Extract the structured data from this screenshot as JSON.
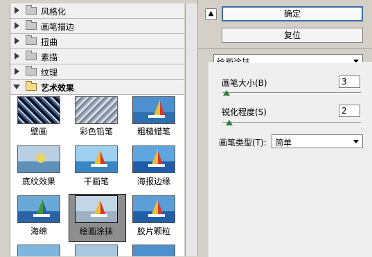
{
  "categories": [
    {
      "label": "风格化"
    },
    {
      "label": "画笔描边"
    },
    {
      "label": "扭曲"
    },
    {
      "label": "素描"
    },
    {
      "label": "纹理"
    },
    {
      "label": "艺术效果"
    }
  ],
  "filters": [
    {
      "label": "壁画"
    },
    {
      "label": "彩色铅笔"
    },
    {
      "label": "粗糙蜡笔"
    },
    {
      "label": "底纹效果"
    },
    {
      "label": "干画笔"
    },
    {
      "label": "海报边缘"
    },
    {
      "label": "海绵"
    },
    {
      "label": "绘画涂抹"
    },
    {
      "label": "胶片颗粒"
    }
  ],
  "buttons": {
    "ok": "确定",
    "reset": "复位"
  },
  "collapse_icon": "▲",
  "selected_filter": "绘画涂抹",
  "params": {
    "brush_size": {
      "label": "画笔大小(B)",
      "value": "3",
      "level_fraction": 0.03
    },
    "sharpness": {
      "label": "锐化程度(S)",
      "value": "2",
      "level_fraction": 0.05
    },
    "brush_type": {
      "label": "画笔类型(T):",
      "value": "简单"
    }
  }
}
